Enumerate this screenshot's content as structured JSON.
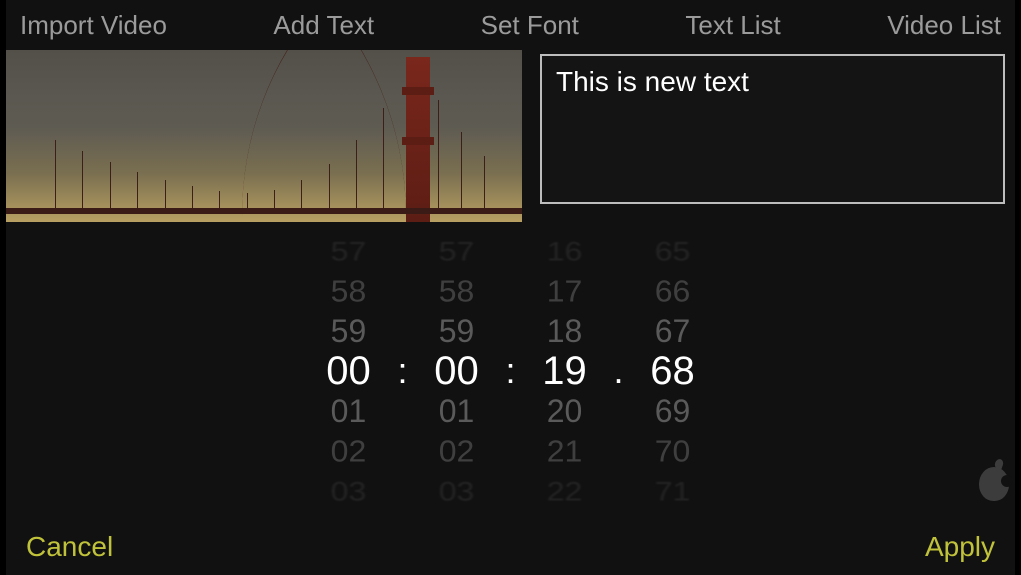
{
  "topbar": {
    "import_video": "Import Video",
    "add_text": "Add Text",
    "set_font": "Set Font",
    "text_list": "Text List",
    "video_list": "Video List"
  },
  "text_input": {
    "value": "This is new text"
  },
  "picker": {
    "sep_colon": ":",
    "sep_dot": ".",
    "col1": {
      "m3": "57",
      "m2": "58",
      "m1": "59",
      "sel": "00",
      "p1": "01",
      "p2": "02",
      "p3": "03"
    },
    "col2": {
      "m3": "57",
      "m2": "58",
      "m1": "59",
      "sel": "00",
      "p1": "01",
      "p2": "02",
      "p3": "03"
    },
    "col3": {
      "m3": "16",
      "m2": "17",
      "m1": "18",
      "sel": "19",
      "p1": "20",
      "p2": "21",
      "p3": "22"
    },
    "col4": {
      "m3": "65",
      "m2": "66",
      "m1": "67",
      "sel": "68",
      "p1": "69",
      "p2": "70",
      "p3": "71"
    }
  },
  "bottombar": {
    "cancel": "Cancel",
    "apply": "Apply"
  }
}
